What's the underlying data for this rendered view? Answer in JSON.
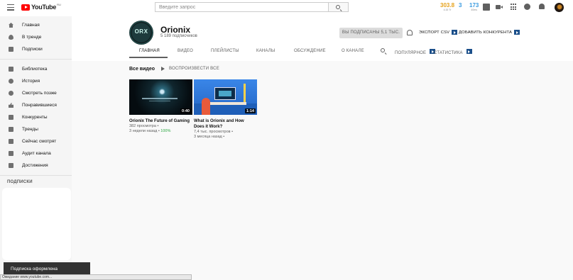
{
  "topbar": {
    "logo_text": "YouTube",
    "logo_region": "RU",
    "search_placeholder": "Введите запрос",
    "stats": [
      {
        "value": "303.8",
        "sub": "4.15 Tr",
        "color": "#e6a21c"
      },
      {
        "value": "3",
        "sub": "",
        "color": "#3b9be0"
      },
      {
        "value": "173",
        "sub": "40ms",
        "color": "#3b9be0"
      }
    ],
    "icons": [
      "stats-grid-icon",
      "create-video-icon",
      "apps-grid-icon",
      "messages-icon",
      "notifications-bell-icon"
    ]
  },
  "sidebar": {
    "main": [
      {
        "label": "Главная",
        "icon": "home-icon"
      },
      {
        "label": "В тренде",
        "icon": "trending-icon"
      },
      {
        "label": "Подписки",
        "icon": "subscriptions-icon"
      }
    ],
    "library": [
      {
        "label": "Библиотека",
        "icon": "library-icon"
      },
      {
        "label": "История",
        "icon": "history-icon"
      },
      {
        "label": "Смотреть позже",
        "icon": "watch-later-icon"
      },
      {
        "label": "Понравившиеся",
        "icon": "liked-icon"
      },
      {
        "label": "Конкуренты",
        "icon": "vidiq-icon"
      },
      {
        "label": "Тренды",
        "icon": "vidiq-icon"
      },
      {
        "label": "Сейчас смотрят",
        "icon": "vidiq-icon"
      },
      {
        "label": "Аудит канала",
        "icon": "vidiq-icon"
      },
      {
        "label": "Достижения",
        "icon": "vidiq-icon"
      }
    ],
    "subscriptions_heading": "ПОДПИСКИ"
  },
  "channel": {
    "avatar_text": "ORX",
    "name": "Orionix",
    "subscribers": "5 189 подписчиков",
    "subscribed_button": "ВЫ ПОДПИСАНЫ  5,1 ТЫС.",
    "export_label": "ЭКСПОРТ CSV",
    "add_competitor_label": "ДОБАВИТЬ КОНКУРЕНТА",
    "tabs": [
      {
        "label": "ГЛАВНАЯ",
        "active": true
      },
      {
        "label": "ВИДЕО"
      },
      {
        "label": "ПЛЕЙЛИСТЫ"
      },
      {
        "label": "КАНАЛЫ"
      },
      {
        "label": "ОБСУЖДЕНИЕ"
      },
      {
        "label": "О КАНАЛЕ"
      },
      {
        "label": "ПОПУЛЯРНОЕ"
      },
      {
        "label": "СТАТИСТИКА"
      }
    ]
  },
  "videos_section": {
    "title": "Все видео",
    "play_all": "ВОСПРОИЗВЕСТИ ВСЕ",
    "videos": [
      {
        "title": "Orionix The Future of Gaming",
        "title2": "",
        "duration": "0:40",
        "views": "382 просмотра",
        "age": "3 недели назад",
        "score": "100%"
      },
      {
        "title": "What is Orionix and How",
        "title2": "Does it Work?",
        "duration": "1:14",
        "views": "7,4 тыс. просмотров",
        "age": "3 месяца назад",
        "score": ""
      }
    ]
  },
  "toast": "Подписка оформлена",
  "status_bar": "Ожидание www.youtube.com..."
}
